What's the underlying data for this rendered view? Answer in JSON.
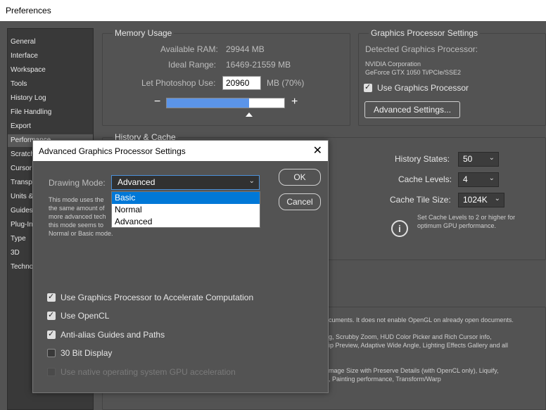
{
  "window": {
    "title": "Preferences"
  },
  "sidebar": {
    "items": [
      {
        "label": "General"
      },
      {
        "label": "Interface"
      },
      {
        "label": "Workspace"
      },
      {
        "label": "Tools"
      },
      {
        "label": "History Log"
      },
      {
        "label": "File Handling"
      },
      {
        "label": "Export"
      },
      {
        "label": "Performance"
      },
      {
        "label": "Scratch"
      },
      {
        "label": "Cursor"
      },
      {
        "label": "Transp"
      },
      {
        "label": "Units &"
      },
      {
        "label": "Guides"
      },
      {
        "label": "Plug-In"
      },
      {
        "label": "Type"
      },
      {
        "label": "3D"
      },
      {
        "label": "Techno"
      }
    ],
    "selected": "Performance"
  },
  "memory": {
    "title": "Memory Usage",
    "available_label": "Available RAM:",
    "available_value": "29944 MB",
    "ideal_label": "Ideal Range:",
    "ideal_value": "16469-21559 MB",
    "let_label": "Let Photoshop Use:",
    "let_value": "20960",
    "let_suffix": "MB (70%)",
    "slider_fraction": 0.7,
    "minus": "−",
    "plus": "+"
  },
  "gpu": {
    "title": "Graphics Processor Settings",
    "detected_label": "Detected Graphics Processor:",
    "vendor": "NVIDIA Corporation",
    "model": "GeForce GTX 1050 Ti/PCIe/SSE2",
    "use_label": "Use Graphics Processor",
    "use_checked": true,
    "advanced_button": "Advanced Settings..."
  },
  "history": {
    "title": "History & Cache",
    "states_label": "History States:",
    "states_value": "50",
    "levels_label": "Cache Levels:",
    "levels_value": "4",
    "tile_label": "Cache Tile Size:",
    "tile_value": "1024K",
    "hint_line1": "Set Cache Levels to 2 or higher for",
    "hint_line2": "optimum GPU performance."
  },
  "description": {
    "line1": "cuments. It does not enable OpenGL on already open documents.",
    "line2": "g, Scrubby Zoom, HUD Color Picker and Rich Cursor info,",
    "line3": "ip Preview, Adaptive Wide Angle, Lighting Effects Gallery and all",
    "line4": "mage Size with Preserve Details (with OpenCL only), Liquify,",
    "line5": ", Painting performance, Transform/Warp"
  },
  "dialog": {
    "title": "Advanced Graphics Processor Settings",
    "close": "✕",
    "drawing_mode_label": "Drawing Mode:",
    "drawing_mode_value": "Advanced",
    "options": [
      "Basic",
      "Normal",
      "Advanced"
    ],
    "highlighted_option": "Basic",
    "desc_line1": "This mode uses the",
    "desc_line2": "the same amount of",
    "desc_line3": "more advanced tech",
    "desc_line4": "this mode seems to",
    "desc_line5": "Normal or Basic mode.",
    "ok_button": "OK",
    "cancel_button": "Cancel",
    "checks": [
      {
        "label": "Use Graphics Processor to Accelerate Computation",
        "state": "on"
      },
      {
        "label": "Use OpenCL",
        "state": "on"
      },
      {
        "label": "Anti-alias Guides and Paths",
        "state": "on"
      },
      {
        "label": "30 Bit Display",
        "state": "off"
      },
      {
        "label": "Use native operating system GPU acceleration",
        "state": "disabled"
      }
    ]
  }
}
